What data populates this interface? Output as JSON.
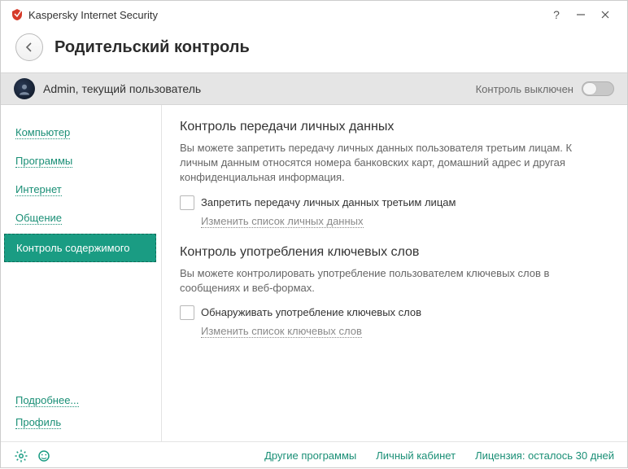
{
  "app_title": "Kaspersky Internet Security",
  "page_title": "Родительский контроль",
  "user": {
    "name": "Admin, текущий пользователь",
    "control_state": "Контроль выключен"
  },
  "sidebar": {
    "items": [
      {
        "label": "Компьютер"
      },
      {
        "label": "Программы"
      },
      {
        "label": "Интернет"
      },
      {
        "label": "Общение"
      },
      {
        "label": "Контроль содержимого"
      }
    ],
    "more": "Подробнее...",
    "profile": "Профиль"
  },
  "content": {
    "section1": {
      "heading": "Контроль передачи личных данных",
      "desc": "Вы можете запретить передачу личных данных пользователя третьим лицам. К личным данным относятся номера банковских карт, домашний адрес и другая конфиденциальная информация.",
      "checkbox": "Запретить передачу личных данных третьим лицам",
      "link": "Изменить список личных данных"
    },
    "section2": {
      "heading": "Контроль употребления ключевых слов",
      "desc": "Вы можете контролировать употребление пользователем ключевых слов в сообщениях и веб-формах.",
      "checkbox": "Обнаруживать употребление ключевых слов",
      "link": "Изменить список ключевых слов"
    }
  },
  "footer": {
    "other_programs": "Другие программы",
    "account": "Личный кабинет",
    "license": "Лицензия: осталось 30 дней"
  }
}
